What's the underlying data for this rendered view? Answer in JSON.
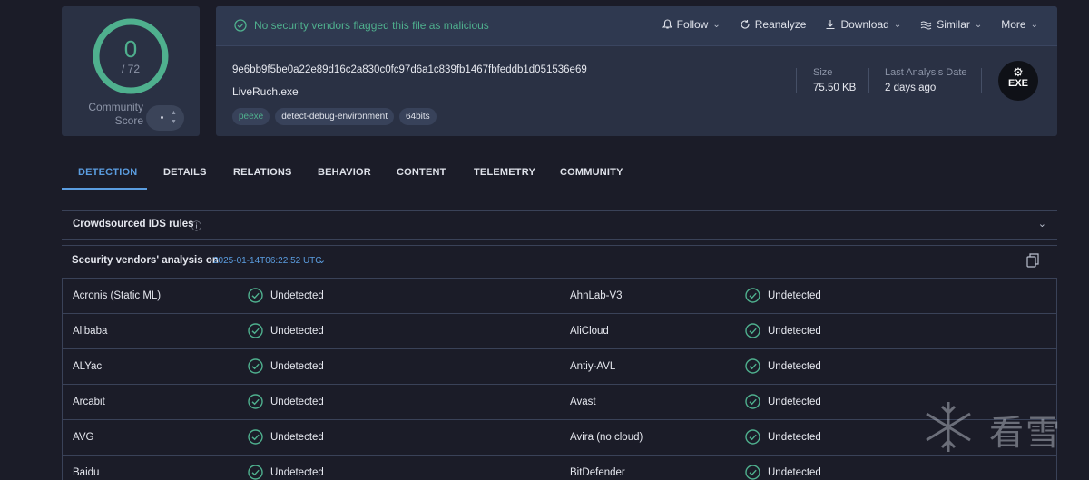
{
  "score": {
    "value": "0",
    "total": "/ 72",
    "community_label": "Community Score"
  },
  "summary": {
    "status_message": "No security vendors flagged this file as malicious",
    "actions": [
      {
        "label": "Follow",
        "icon": "bell-icon",
        "has_dropdown": true
      },
      {
        "label": "Reanalyze",
        "icon": "refresh-icon",
        "has_dropdown": false
      },
      {
        "label": "Download",
        "icon": "download-icon",
        "has_dropdown": true
      },
      {
        "label": "Similar",
        "icon": "similar-icon",
        "has_dropdown": true
      },
      {
        "label": "More",
        "icon": "",
        "has_dropdown": true
      }
    ],
    "hash": "9e6bb9f5be0a22e89d16c2a830c0fc97d6a1c839fb1467fbfeddb1d051536e69",
    "file_name": "LiveRuch.exe",
    "tags": [
      "peexe",
      "detect-debug-environment",
      "64bits"
    ],
    "size_label": "Size",
    "size_value": "75.50 KB",
    "date_label": "Last Analysis Date",
    "date_value": "2 days ago",
    "file_type": "EXE"
  },
  "tabs": [
    "DETECTION",
    "DETAILS",
    "RELATIONS",
    "BEHAVIOR",
    "CONTENT",
    "TELEMETRY",
    "COMMUNITY"
  ],
  "ids": {
    "title": "Crowdsourced IDS rules",
    "info_icon": "ⓘ"
  },
  "vendors_section": {
    "title": "Security vendors' analysis on",
    "date": "2025-01-14T06:22:52 UTC"
  },
  "rows": [
    {
      "left_vendor": "Acronis (Static ML)",
      "left_result": "Undetected",
      "right_vendor": "AhnLab-V3",
      "right_result": "Undetected"
    },
    {
      "left_vendor": "Alibaba",
      "left_result": "Undetected",
      "right_vendor": "AliCloud",
      "right_result": "Undetected"
    },
    {
      "left_vendor": "ALYac",
      "left_result": "Undetected",
      "right_vendor": "Antiy-AVL",
      "right_result": "Undetected"
    },
    {
      "left_vendor": "Arcabit",
      "left_result": "Undetected",
      "right_vendor": "Avast",
      "right_result": "Undetected"
    },
    {
      "left_vendor": "AVG",
      "left_result": "Undetected",
      "right_vendor": "Avira (no cloud)",
      "right_result": "Undetected"
    },
    {
      "left_vendor": "Baidu",
      "left_result": "Undetected",
      "right_vendor": "BitDefender",
      "right_result": "Undetected"
    }
  ],
  "watermark": "看雪",
  "colors": {
    "accent": "#5b9de0",
    "clean": "#4fb08e",
    "panel": "#2a3144",
    "background": "#1b1c28"
  }
}
